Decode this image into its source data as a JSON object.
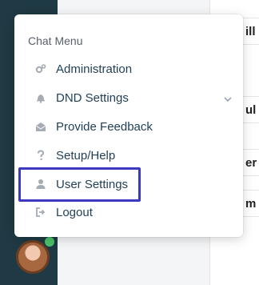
{
  "menu": {
    "title": "Chat Menu",
    "items": [
      {
        "label": "Administration",
        "icon": "gears-icon"
      },
      {
        "label": "DND Settings",
        "icon": "bell-icon"
      },
      {
        "label": "Provide Feedback",
        "icon": "envelope-open-icon"
      },
      {
        "label": "Setup/Help",
        "icon": "question-icon"
      },
      {
        "label": "User Settings",
        "icon": "user-icon"
      },
      {
        "label": "Logout",
        "icon": "sign-out-icon"
      }
    ]
  },
  "background": {
    "fragments": [
      "ill",
      "ul",
      "er",
      "m"
    ]
  },
  "colors": {
    "highlight": "#3b38c4",
    "rail": "#1f3a44",
    "presence": "#4cc26b",
    "label": "#1f3f57"
  }
}
